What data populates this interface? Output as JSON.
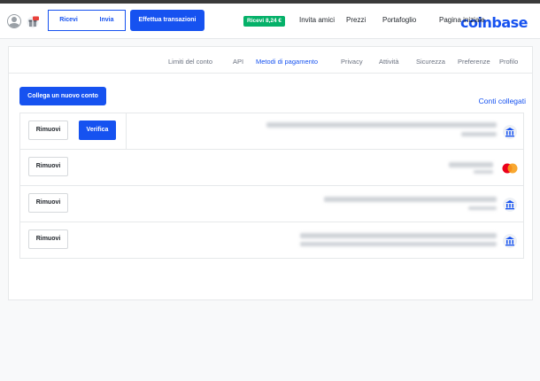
{
  "header": {
    "logo": "coinbase",
    "nav": [
      "Pagina iniziale",
      "Portafoglio",
      "Prezzi",
      "Invita amici"
    ],
    "promo": "Ricevi 8,24 €",
    "transact_label": "Effettua transazioni",
    "send_label": "Invia",
    "receive_label": "Ricevi"
  },
  "tabs": [
    "Profilo",
    "Preferenze",
    "Sicurezza",
    "Attività",
    "Privacy",
    "Metodi di pagamento",
    "API",
    "Limiti del conto"
  ],
  "active_tab": "Metodi di pagamento",
  "section": {
    "title": "Conti collegati",
    "link_button": "Collega un nuovo conto"
  },
  "accounts": [
    {
      "type": "bank",
      "remove_label": "Rimuovi",
      "verify_label": "Verifica"
    },
    {
      "type": "card",
      "remove_label": "Rimuovi"
    },
    {
      "type": "bank",
      "remove_label": "Rimuovi"
    },
    {
      "type": "bank",
      "remove_label": "Rimuovi"
    }
  ],
  "colors": {
    "accent": "#1652f0",
    "promo": "#05b169",
    "card_red": "#eb001b",
    "card_orange": "#f79e1b"
  }
}
